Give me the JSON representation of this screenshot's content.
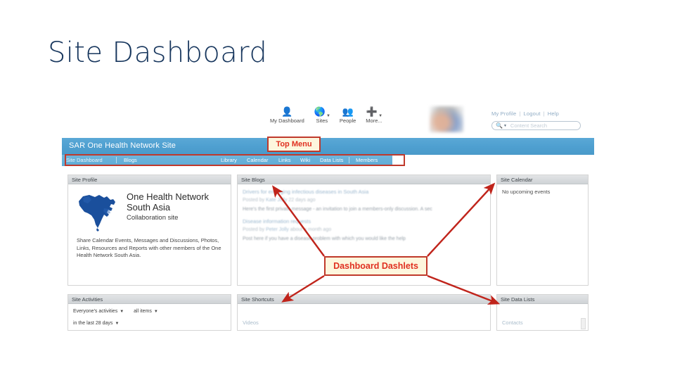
{
  "slide": {
    "title": "Site Dashboard",
    "title_color": "#17365d",
    "background": "#ffffff"
  },
  "screenshot": {
    "global_toolbar": {
      "nav_items": [
        {
          "label": "My Dashboard",
          "icon": "person-icon",
          "has_caret": false
        },
        {
          "label": "Sites",
          "icon": "globe-icon",
          "has_caret": true
        },
        {
          "label": "People",
          "icon": "people-icon",
          "has_caret": false
        },
        {
          "label": "More...",
          "icon": "plus-icon",
          "has_caret": true
        }
      ],
      "avatar": {
        "name": "avatar",
        "blurred": true
      },
      "user_links": [
        {
          "label": "My Profile"
        },
        {
          "label": "Logout"
        },
        {
          "label": "Help"
        }
      ],
      "separator": "|",
      "search": {
        "placeholder": "Content Search",
        "icon": "search-icon",
        "caret": "chevron-down-icon"
      }
    },
    "site_banner": {
      "site_name": "SAR One Health Network Site",
      "background": "#4e9fd0"
    },
    "site_nav": {
      "tabs": [
        {
          "label": "Site Dashboard",
          "selected": true
        },
        {
          "label": "Blogs",
          "selected": false
        },
        {
          "label": "Library",
          "selected": false
        },
        {
          "label": "Calendar",
          "selected": false
        },
        {
          "label": "Links",
          "selected": false
        },
        {
          "label": "Wiki",
          "selected": false
        },
        {
          "label": "Data Lists",
          "selected": false
        },
        {
          "label": "Members",
          "selected": false
        }
      ]
    },
    "dashlets": {
      "site_profile": {
        "header": "Site Profile",
        "logo": "south-asia-map-icon",
        "heading": "One Health Network South Asia",
        "subheading": "Collaboration site",
        "description": "Share Calendar Events, Messages and Discussions, Photos, Links, Resources and Reports with other members of the One Health Network South Asia."
      },
      "site_blogs": {
        "header": "Site Blogs",
        "posts": [
          {
            "title": "Drivers for emerging infectious diseases in South Asia",
            "meta_prefix": "Posted by",
            "author": "Kate Jolly",
            "meta_suffix": "22 days ago",
            "excerpt": "Here's the first private message - an invitation to join a members-only discussion.  A sec"
          },
          {
            "title": "Disease information requests",
            "meta_prefix": "Posted by",
            "author": "Peter Jolly",
            "meta_suffix": "about a month ago",
            "excerpt": "Post here if you have a disease problem with which you would like the help"
          }
        ]
      },
      "site_calendar": {
        "header": "Site Calendar",
        "empty_message": "No upcoming events"
      },
      "site_activities": {
        "header": "Site Activities",
        "filters": [
          {
            "label": "Everyone's activities",
            "caret": "▼"
          },
          {
            "label": "all items",
            "caret": "▼"
          },
          {
            "label": "in the last 28 days",
            "caret": "▼"
          }
        ]
      },
      "site_shortcuts": {
        "header": "Site Shortcuts",
        "items": [
          {
            "label": "Videos"
          }
        ]
      },
      "site_data_lists": {
        "header": "Site Data Lists",
        "items": [
          {
            "label": "Contacts"
          }
        ]
      }
    }
  },
  "annotations": {
    "top_menu": {
      "label": "Top Menu",
      "color": "#e03020",
      "fill": "#fdf6dd",
      "border": "#c0392b"
    },
    "dashboard_dashlets": {
      "label": "Dashboard Dashlets",
      "color": "#e03020",
      "fill": "#fdf6dd",
      "border": "#c0392b"
    },
    "arrow_color": "#c0241b",
    "arrow_targets": [
      "site-blogs",
      "site-calendar",
      "site-shortcuts",
      "site-data-lists"
    ]
  }
}
